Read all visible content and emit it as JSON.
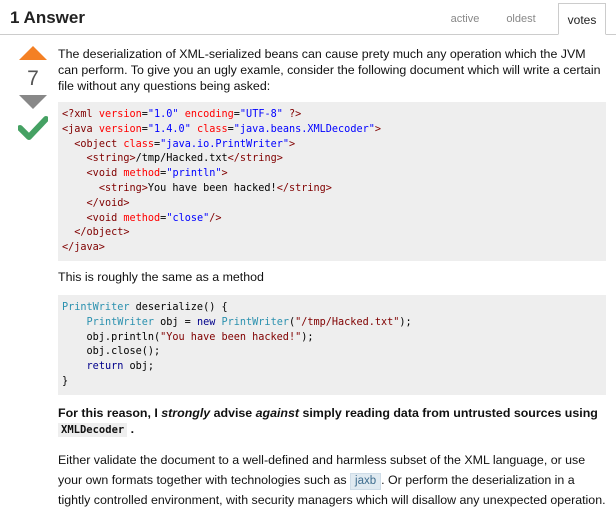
{
  "header": {
    "answer_count": "1 Answer",
    "tabs": [
      {
        "label": "active",
        "selected": false
      },
      {
        "label": "oldest",
        "selected": false
      },
      {
        "label": "votes",
        "selected": true
      }
    ]
  },
  "vote": {
    "count": "7",
    "accepted": true,
    "colors": {
      "up": "#f48024",
      "down": "#888888",
      "accepted": "#45a163"
    }
  },
  "post": {
    "intro": "The deserialization of XML-serialized beans can cause prety much any operation which the JVM can perform. To give you an ugly examle, consider the following document which will write a certain file without any questions being asked:",
    "xml_code": [
      [
        {
          "t": "tag",
          "s": "<?xml "
        },
        {
          "t": "attr",
          "s": "version"
        },
        {
          "t": "txt",
          "s": "="
        },
        {
          "t": "str",
          "s": "\"1.0\""
        },
        {
          "t": "txt",
          "s": " "
        },
        {
          "t": "attr",
          "s": "encoding"
        },
        {
          "t": "txt",
          "s": "="
        },
        {
          "t": "str",
          "s": "\"UTF-8\""
        },
        {
          "t": "tag",
          "s": " ?>"
        }
      ],
      [
        {
          "t": "tag",
          "s": "<java "
        },
        {
          "t": "attr",
          "s": "version"
        },
        {
          "t": "txt",
          "s": "="
        },
        {
          "t": "str",
          "s": "\"1.4.0\""
        },
        {
          "t": "txt",
          "s": " "
        },
        {
          "t": "attr",
          "s": "class"
        },
        {
          "t": "txt",
          "s": "="
        },
        {
          "t": "str",
          "s": "\"java.beans.XMLDecoder\""
        },
        {
          "t": "tag",
          "s": ">"
        }
      ],
      [
        {
          "t": "txt",
          "s": "  "
        },
        {
          "t": "tag",
          "s": "<object "
        },
        {
          "t": "attr",
          "s": "class"
        },
        {
          "t": "txt",
          "s": "="
        },
        {
          "t": "str",
          "s": "\"java.io.PrintWriter\""
        },
        {
          "t": "tag",
          "s": ">"
        }
      ],
      [
        {
          "t": "txt",
          "s": "    "
        },
        {
          "t": "tag",
          "s": "<string>"
        },
        {
          "t": "txt",
          "s": "/tmp/Hacked.txt"
        },
        {
          "t": "tag",
          "s": "</string>"
        }
      ],
      [
        {
          "t": "txt",
          "s": "    "
        },
        {
          "t": "tag",
          "s": "<void "
        },
        {
          "t": "attr",
          "s": "method"
        },
        {
          "t": "txt",
          "s": "="
        },
        {
          "t": "str",
          "s": "\"println\""
        },
        {
          "t": "tag",
          "s": ">"
        }
      ],
      [
        {
          "t": "txt",
          "s": "      "
        },
        {
          "t": "tag",
          "s": "<string>"
        },
        {
          "t": "txt",
          "s": "You have been hacked!"
        },
        {
          "t": "tag",
          "s": "</string>"
        }
      ],
      [
        {
          "t": "txt",
          "s": "    "
        },
        {
          "t": "tag",
          "s": "</void>"
        }
      ],
      [
        {
          "t": "txt",
          "s": "    "
        },
        {
          "t": "tag",
          "s": "<void "
        },
        {
          "t": "attr",
          "s": "method"
        },
        {
          "t": "txt",
          "s": "="
        },
        {
          "t": "str",
          "s": "\"close\""
        },
        {
          "t": "tag",
          "s": "/>"
        }
      ],
      [
        {
          "t": "txt",
          "s": "  "
        },
        {
          "t": "tag",
          "s": "</object>"
        }
      ],
      [
        {
          "t": "tag",
          "s": "</java>"
        }
      ]
    ],
    "middle": "This is roughly the same as a method",
    "java_code": [
      [
        {
          "t": "type",
          "s": "PrintWriter"
        },
        {
          "t": "txt",
          "s": " deserialize() {"
        }
      ],
      [
        {
          "t": "txt",
          "s": "    "
        },
        {
          "t": "type",
          "s": "PrintWriter"
        },
        {
          "t": "txt",
          "s": " obj = "
        },
        {
          "t": "kw",
          "s": "new"
        },
        {
          "t": "txt",
          "s": " "
        },
        {
          "t": "type",
          "s": "PrintWriter"
        },
        {
          "t": "txt",
          "s": "("
        },
        {
          "t": "strj",
          "s": "\"/tmp/Hacked.txt\""
        },
        {
          "t": "txt",
          "s": ");"
        }
      ],
      [
        {
          "t": "txt",
          "s": "    obj.println("
        },
        {
          "t": "strj",
          "s": "\"You have been hacked!\""
        },
        {
          "t": "txt",
          "s": ");"
        }
      ],
      [
        {
          "t": "txt",
          "s": "    obj.close();"
        }
      ],
      [
        {
          "t": "txt",
          "s": "    "
        },
        {
          "t": "kw",
          "s": "return"
        },
        {
          "t": "txt",
          "s": " obj;"
        }
      ],
      [
        {
          "t": "txt",
          "s": "}"
        }
      ]
    ],
    "advice": {
      "part1": "For this reason, I ",
      "strongly": "strongly",
      "part2": " advise ",
      "against": "against",
      "part3": " simply reading data from untrusted sources using",
      "code": "XMLDecoder",
      "end": "."
    },
    "closing": {
      "part1": "Either validate the document to a well-defined and harmless subset of the XML language, or use your own formats together with technologies such as ",
      "tag": "jaxb",
      "part2": ". Or perform the deserialization in a tightly controlled environment, with security managers which will disallow any unexpected operation."
    }
  }
}
